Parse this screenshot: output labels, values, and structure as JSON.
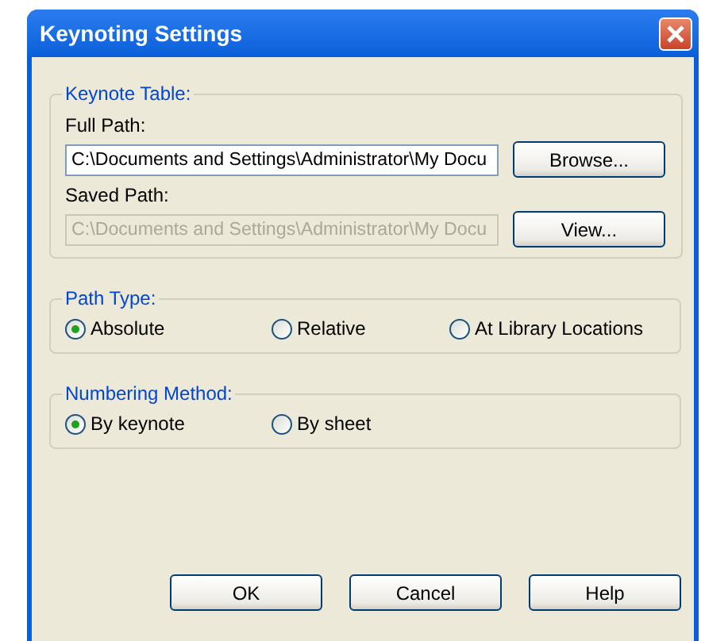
{
  "window": {
    "title": "Keynoting Settings"
  },
  "keynote_table": {
    "label": "Keynote Table:",
    "fields": [
      {
        "label": "Full Path:",
        "value": "C:\\Documents and Settings\\Administrator\\My Docu",
        "disabled": false,
        "button": "Browse..."
      },
      {
        "label": "Saved Path:",
        "value": "C:\\Documents and Settings\\Administrator\\My Docu",
        "disabled": true,
        "button": "View..."
      }
    ]
  },
  "groups": [
    {
      "label": "Path Type:",
      "options": [
        {
          "label": "Absolute",
          "selected": true
        },
        {
          "label": "Relative",
          "selected": false
        },
        {
          "label": "At Library Locations",
          "selected": false
        }
      ]
    },
    {
      "label": "Numbering Method:",
      "options": [
        {
          "label": "By keynote",
          "selected": true
        },
        {
          "label": "By sheet",
          "selected": false
        }
      ]
    }
  ],
  "buttons": [
    "OK",
    "Cancel",
    "Help"
  ]
}
